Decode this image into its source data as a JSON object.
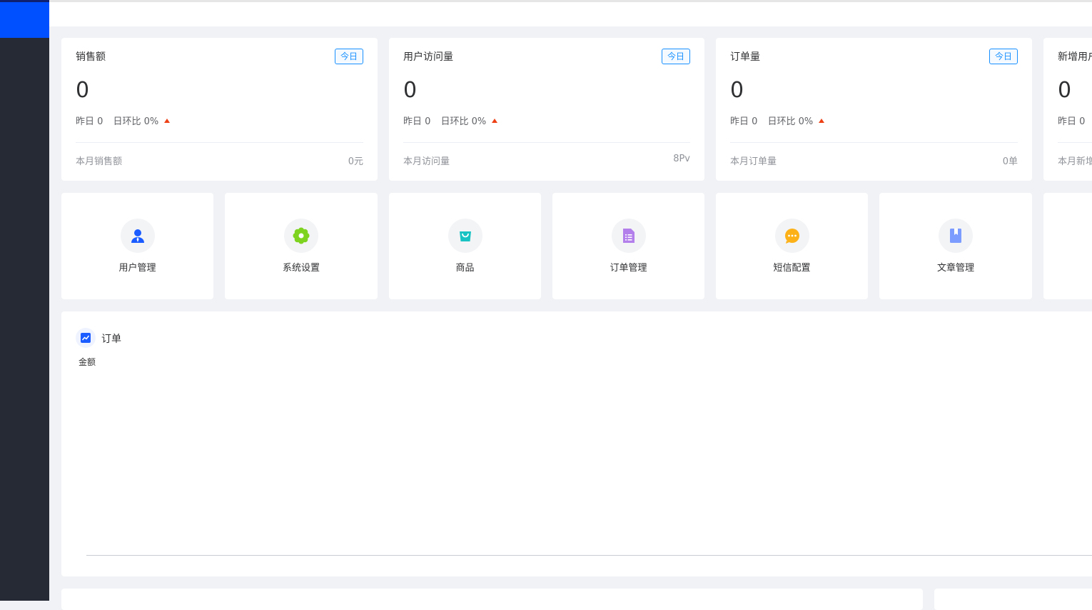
{
  "stats": [
    {
      "title": "销售额",
      "badge": "今日",
      "value": "0",
      "yesterday_label": "昨日",
      "yesterday_value": "0",
      "ratio_label": "日环比",
      "ratio_value": "0%",
      "month_label": "本月销售额",
      "month_value": "0元"
    },
    {
      "title": "用户访问量",
      "badge": "今日",
      "value": "0",
      "yesterday_label": "昨日",
      "yesterday_value": "0",
      "ratio_label": "日环比",
      "ratio_value": "0%",
      "month_label": "本月访问量",
      "month_value": "8Pv"
    },
    {
      "title": "订单量",
      "badge": "今日",
      "value": "0",
      "yesterday_label": "昨日",
      "yesterday_value": "0",
      "ratio_label": "日环比",
      "ratio_value": "0%",
      "month_label": "本月订单量",
      "month_value": "0单"
    },
    {
      "title": "新增用户",
      "badge": "",
      "value": "0",
      "yesterday_label": "昨日",
      "yesterday_value": "0",
      "ratio_label": "",
      "ratio_value": "",
      "month_label": "本月新增",
      "month_value": ""
    }
  ],
  "nav": [
    {
      "label": "用户管理",
      "icon": "user-icon",
      "color": "#1a5cff"
    },
    {
      "label": "系统设置",
      "icon": "gear-icon",
      "color": "#7ed321"
    },
    {
      "label": "商品",
      "icon": "shopping-bag-icon",
      "color": "#19c3c3"
    },
    {
      "label": "订单管理",
      "icon": "document-icon",
      "color": "#b37feb"
    },
    {
      "label": "短信配置",
      "icon": "message-icon",
      "color": "#fbb117"
    },
    {
      "label": "文章管理",
      "icon": "bookmark-book-icon",
      "color": "#7c9cff"
    },
    {
      "label": "",
      "icon": "",
      "color": ""
    }
  ],
  "chart": {
    "title": "订单",
    "icon": "line-chart-icon",
    "accent": "#1a5cff",
    "ylabel": "金额"
  },
  "chart_data": {
    "type": "line",
    "title": "订单",
    "ylabel": "金额",
    "xlabel": "",
    "series": []
  }
}
